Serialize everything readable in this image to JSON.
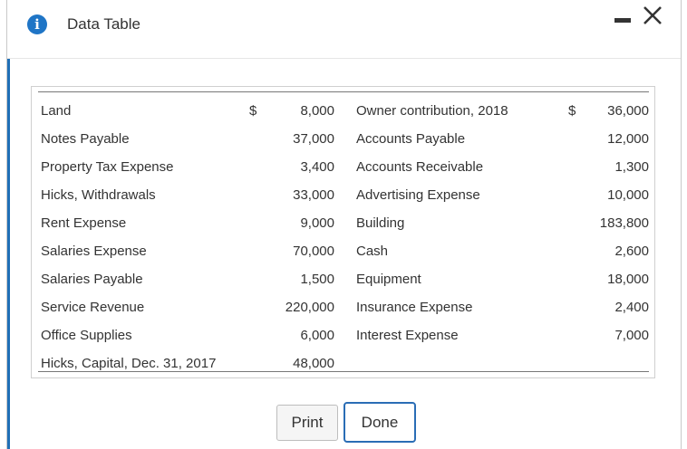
{
  "window": {
    "title": "Data Table",
    "info_icon": "info-icon",
    "info_glyph": "i",
    "accent_color": "#1f75c6"
  },
  "table": {
    "rows": [
      {
        "left_label": "Land",
        "left_currency": "$",
        "left_value": "8,000",
        "right_label": "Owner contribution, 2018",
        "right_currency": "$",
        "right_value": "36,000"
      },
      {
        "left_label": "Notes Payable",
        "left_currency": "",
        "left_value": "37,000",
        "right_label": "Accounts Payable",
        "right_currency": "",
        "right_value": "12,000"
      },
      {
        "left_label": "Property Tax Expense",
        "left_currency": "",
        "left_value": "3,400",
        "right_label": "Accounts Receivable",
        "right_currency": "",
        "right_value": "1,300"
      },
      {
        "left_label": "Hicks, Withdrawals",
        "left_currency": "",
        "left_value": "33,000",
        "right_label": "Advertising Expense",
        "right_currency": "",
        "right_value": "10,000"
      },
      {
        "left_label": "Rent Expense",
        "left_currency": "",
        "left_value": "9,000",
        "right_label": "Building",
        "right_currency": "",
        "right_value": "183,800"
      },
      {
        "left_label": "Salaries Expense",
        "left_currency": "",
        "left_value": "70,000",
        "right_label": "Cash",
        "right_currency": "",
        "right_value": "2,600"
      },
      {
        "left_label": "Salaries Payable",
        "left_currency": "",
        "left_value": "1,500",
        "right_label": "Equipment",
        "right_currency": "",
        "right_value": "18,000"
      },
      {
        "left_label": "Service Revenue",
        "left_currency": "",
        "left_value": "220,000",
        "right_label": "Insurance Expense",
        "right_currency": "",
        "right_value": "2,400"
      },
      {
        "left_label": "Office Supplies",
        "left_currency": "",
        "left_value": "6,000",
        "right_label": "Interest Expense",
        "right_currency": "",
        "right_value": "7,000"
      },
      {
        "left_label": "Hicks, Capital, Dec. 31, 2017",
        "left_currency": "",
        "left_value": "48,000",
        "right_label": "",
        "right_currency": "",
        "right_value": ""
      }
    ]
  },
  "buttons": {
    "print_label": "Print",
    "done_label": "Done"
  }
}
